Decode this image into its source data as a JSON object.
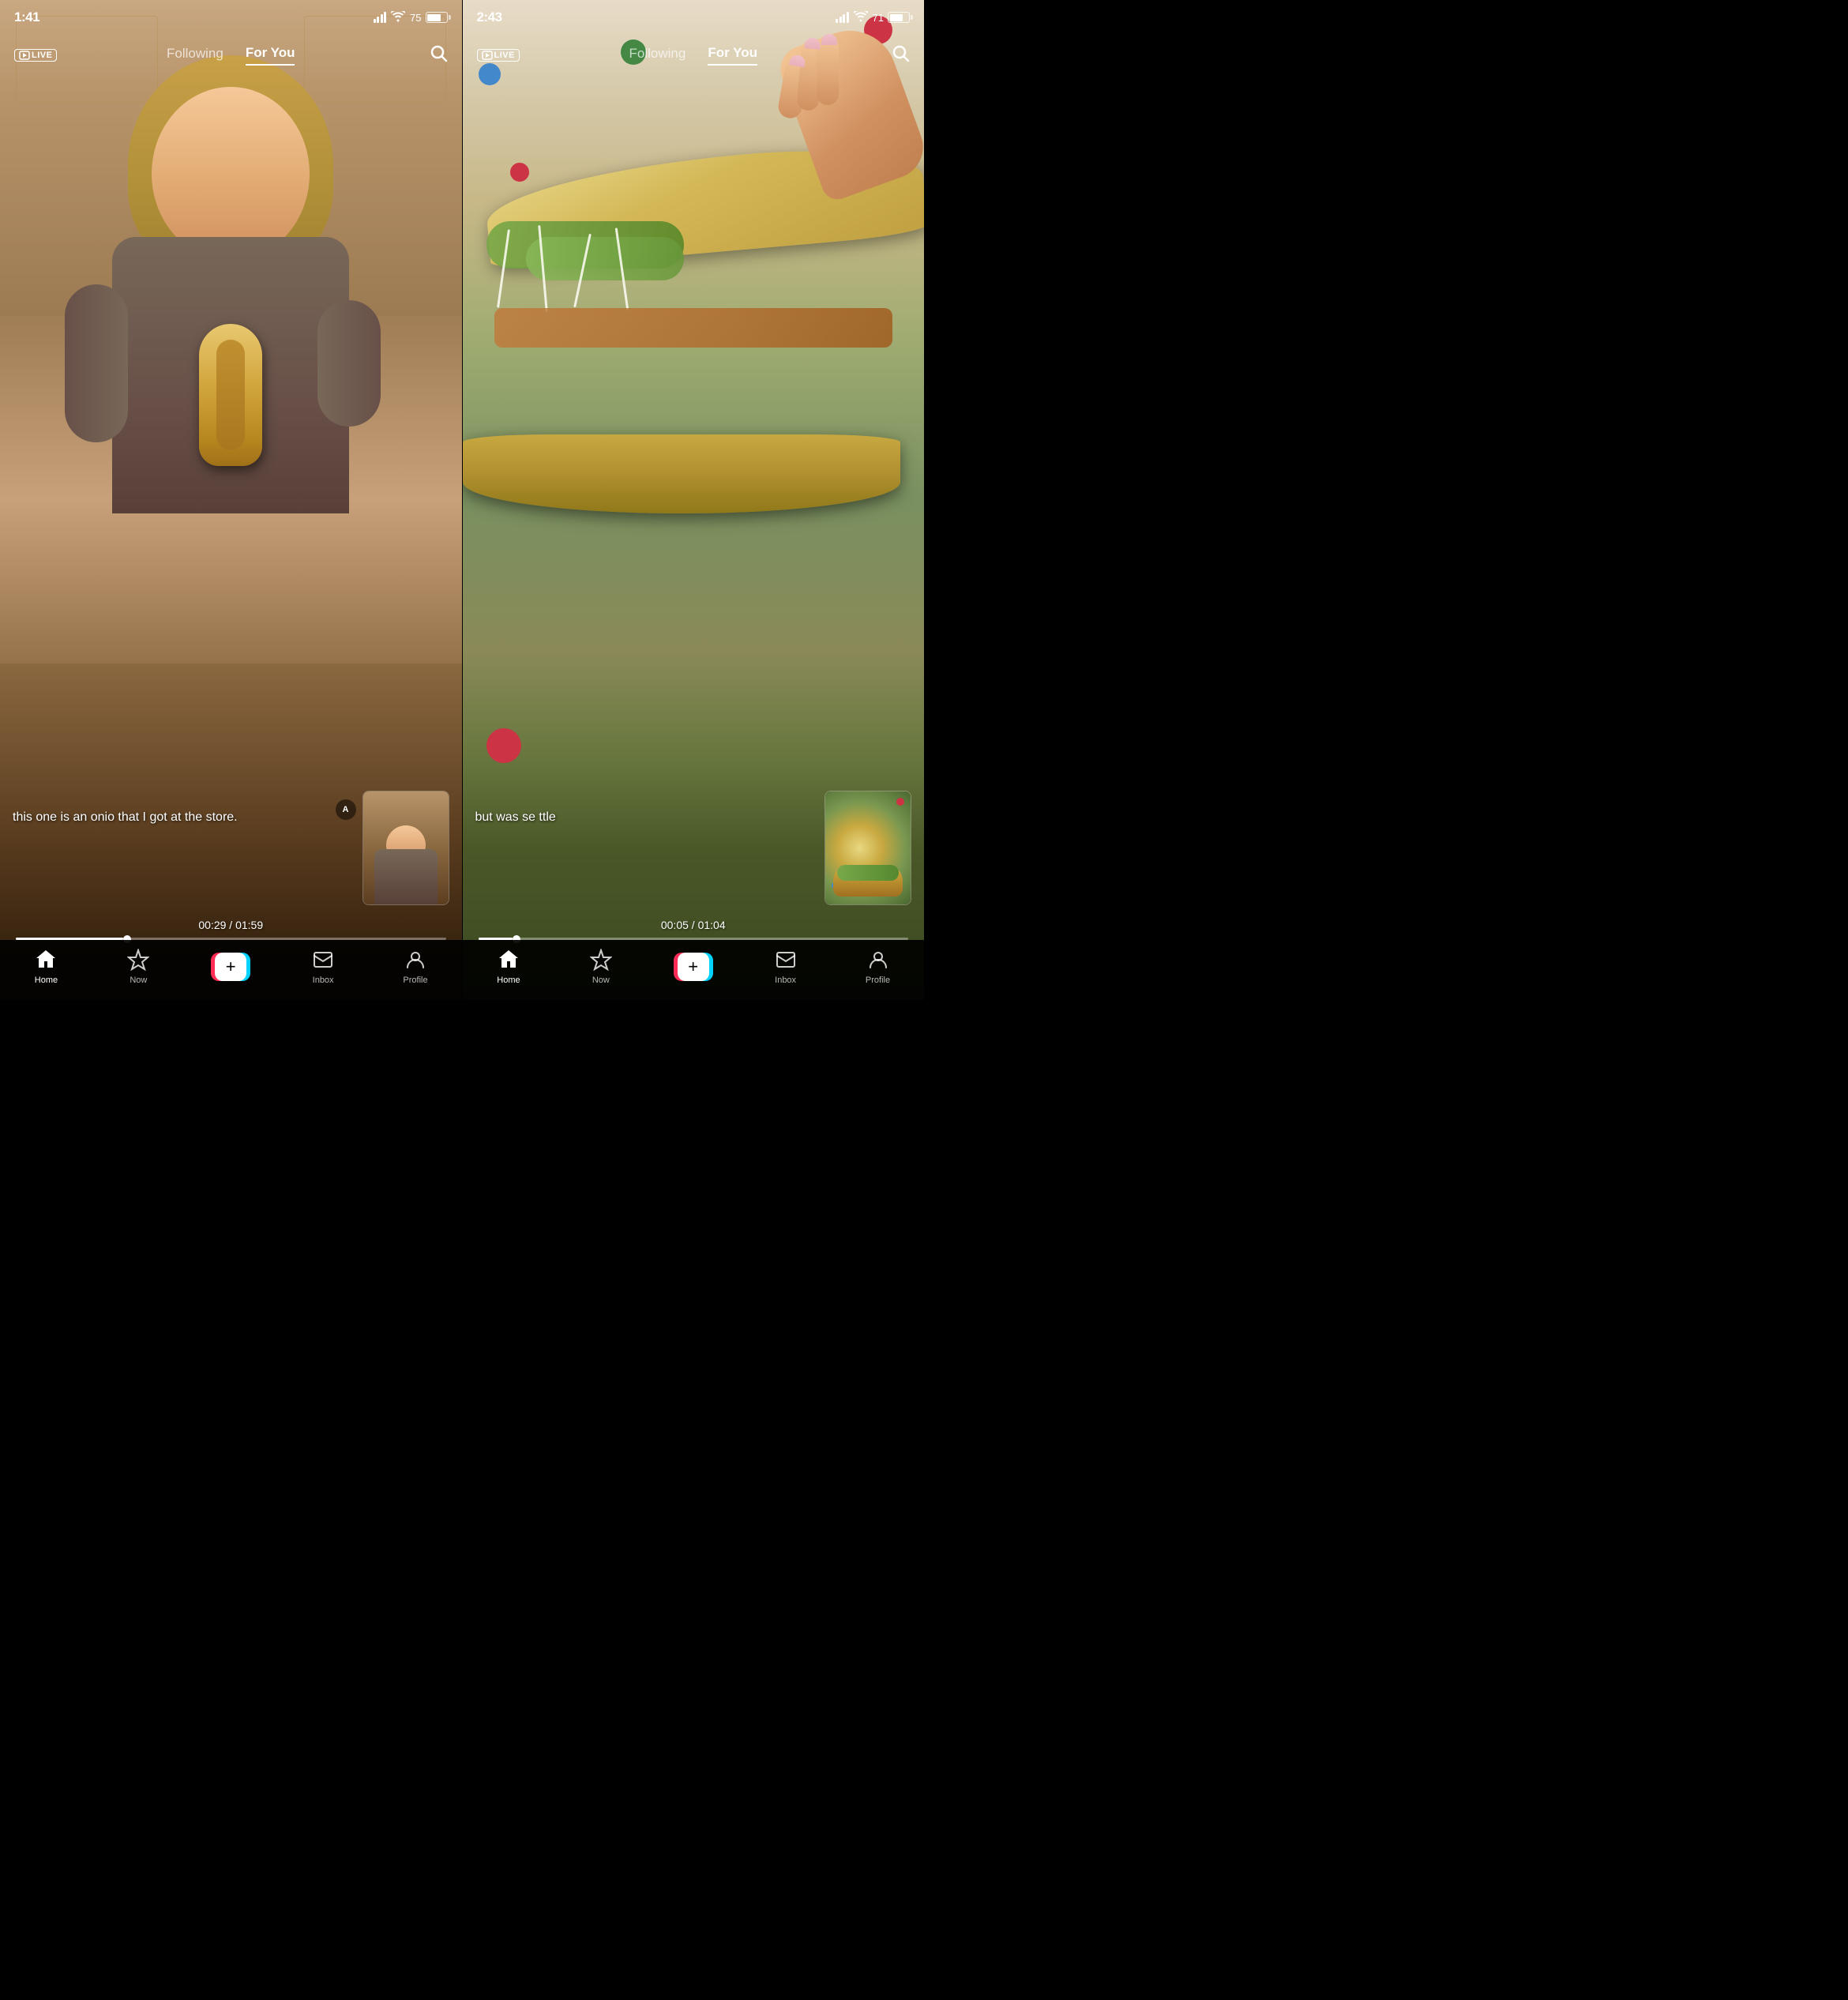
{
  "left_panel": {
    "status": {
      "time": "1:41",
      "signal": [
        3,
        3,
        4
      ],
      "wifi": true,
      "battery_level": 75,
      "battery_label": "75"
    },
    "nav": {
      "live_label": "LIVE",
      "following_label": "Following",
      "foryou_label": "For You",
      "active_tab": "foryou"
    },
    "caption": "this one is an onio\nthat I got at the store.",
    "progress": {
      "current": "00:29",
      "total": "01:59"
    },
    "bottom_nav": {
      "items": [
        {
          "id": "home",
          "label": "Home",
          "active": true
        },
        {
          "id": "now",
          "label": "Now",
          "active": false
        },
        {
          "id": "create",
          "label": "",
          "active": false
        },
        {
          "id": "inbox",
          "label": "Inbox",
          "active": false
        },
        {
          "id": "profile",
          "label": "Profile",
          "active": false
        }
      ]
    }
  },
  "right_panel": {
    "status": {
      "time": "2:43",
      "signal": [
        3,
        3,
        4
      ],
      "wifi": true,
      "battery_level": 71,
      "battery_label": "71"
    },
    "nav": {
      "live_label": "LIVE",
      "following_label": "Following",
      "foryou_label": "For You",
      "active_tab": "foryou"
    },
    "caption": "but         was\nse           ttle",
    "progress": {
      "current": "00:05",
      "total": "01:04"
    },
    "bottom_nav": {
      "items": [
        {
          "id": "home",
          "label": "Home",
          "active": true
        },
        {
          "id": "now",
          "label": "Now",
          "active": false
        },
        {
          "id": "create",
          "label": "",
          "active": false
        },
        {
          "id": "inbox",
          "label": "Inbox",
          "active": false
        },
        {
          "id": "profile",
          "label": "Profile",
          "active": false
        }
      ]
    }
  }
}
